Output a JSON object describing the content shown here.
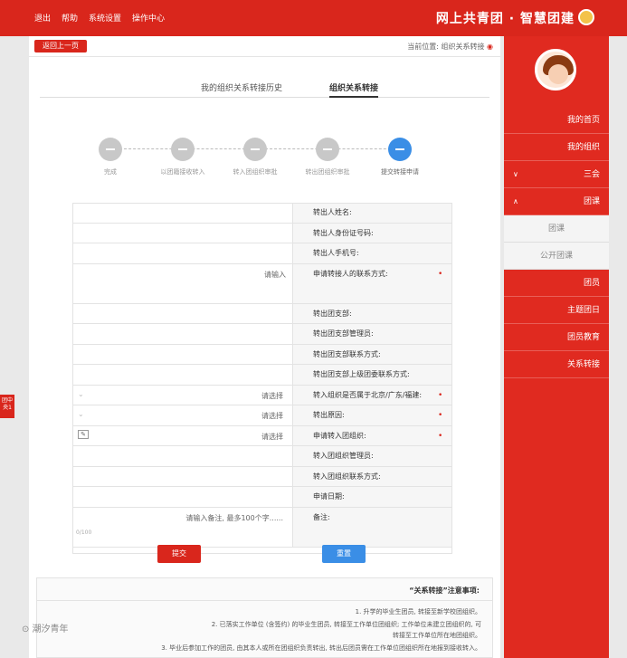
{
  "topbar": {
    "brand": "网上共青团 · 智慧团建",
    "links": [
      "退出",
      "帮助",
      "系统设置",
      "操作中心"
    ]
  },
  "sidebar": {
    "items": [
      {
        "label": "我的首页"
      },
      {
        "label": "我的组织"
      },
      {
        "label": "三会",
        "chevron": "∨"
      },
      {
        "label": "团课",
        "chevron": "∧"
      }
    ],
    "subitems": [
      {
        "label": "团课"
      },
      {
        "label": "公开团课"
      }
    ],
    "items2": [
      {
        "label": "团员"
      },
      {
        "label": "主题团日"
      },
      {
        "label": "团员教育"
      },
      {
        "label": "关系转接"
      }
    ]
  },
  "side_tag": "团中央1",
  "content": {
    "back_button": "返回上一页",
    "breadcrumb": "当前位置: 组织关系转接",
    "tabs": {
      "active": "组织关系转接",
      "other": "我的组织关系转接历史"
    },
    "steps": [
      {
        "label": "提交转接申请"
      },
      {
        "label": "转出团组织审批"
      },
      {
        "label": "转入团组织审批"
      },
      {
        "label": "以团籍接收转入"
      },
      {
        "label": "完成"
      }
    ],
    "form": {
      "rows": [
        {
          "label": "转出人姓名:",
          "value": "",
          "required": false
        },
        {
          "label": "转出人身份证号码:",
          "value": "",
          "required": false
        },
        {
          "label": "转出人手机号:",
          "value": "",
          "required": false
        },
        {
          "label": "申请转接人的联系方式:",
          "value": "",
          "placeholder": "请输入",
          "required": true,
          "tall": true
        },
        {
          "label": "转出团支部:",
          "value": "",
          "required": false
        },
        {
          "label": "转出团支部管理员:",
          "value": "",
          "required": false
        },
        {
          "label": "转出团支部联系方式:",
          "value": "",
          "required": false
        },
        {
          "label": "转出团支部上级团委联系方式:",
          "value": "",
          "required": false
        },
        {
          "label": "转入组织是否属于北京/广东/福建:",
          "value": "",
          "placeholder": "请选择",
          "required": true
        },
        {
          "label": "转出原因:",
          "value": "",
          "placeholder": "请选择",
          "required": true
        },
        {
          "label": "申请转入团组织:",
          "value": "",
          "placeholder": "请选择",
          "required": true
        },
        {
          "label": "转入团组织管理员:",
          "value": "",
          "required": false
        },
        {
          "label": "转入团组织联系方式:",
          "value": "",
          "required": false
        },
        {
          "label": "申请日期:",
          "value": "",
          "required": false
        },
        {
          "label": "备注:",
          "value": "",
          "placeholder": "请输入备注, 最多100个字......",
          "counter": "0/100",
          "required": false,
          "tall": true
        }
      ]
    },
    "buttons": {
      "submit": "提交",
      "reset": "重置"
    },
    "notes": {
      "title": "“关系转接”注意事项:",
      "lines": [
        "1. 升学的毕业生团员, 转接至新学校团组织。",
        "2. 已落实工作单位 (含签约) 的毕业生团员, 转接至工作单位团组织; 工作单位未建立团组织的, 可",
        "转接至工作单位所在地团组织。",
        "3. 毕业后参加工作的团员, 由其本人或所在团组织负责转出, 转出后团员需在工作单位团组织所在地报到接收转入。"
      ]
    }
  },
  "watermark": "⊙ 潮汐青年"
}
